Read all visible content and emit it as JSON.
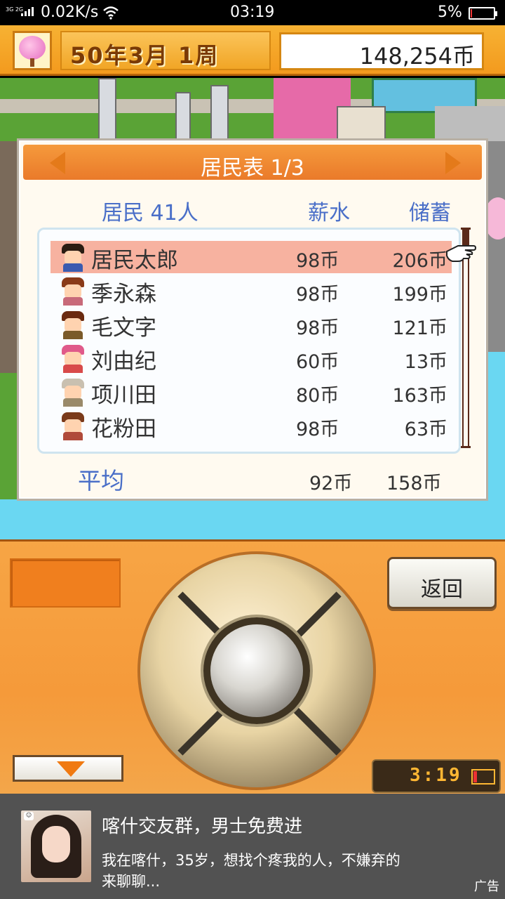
{
  "status_bar": {
    "network": "3G 2G",
    "speed": "0.02K/s",
    "time": "03:19",
    "battery": "5%"
  },
  "top_bar": {
    "date": "50年3月 1周",
    "money": "148,254币"
  },
  "resident_panel": {
    "title": "居民表 1/3",
    "headers": {
      "residents": "居民 41人",
      "salary": "薪水",
      "savings": "储蓄"
    },
    "rows": [
      {
        "name": "居民太郎",
        "salary": "98币",
        "savings": "206币",
        "selected": true,
        "hair": "#2b1c12",
        "body": "#3a5bb0"
      },
      {
        "name": "季永森",
        "salary": "98币",
        "savings": "199币",
        "selected": false,
        "hair": "#8a3a18",
        "body": "#c86a7a"
      },
      {
        "name": "毛文字",
        "salary": "98币",
        "savings": "121币",
        "selected": false,
        "hair": "#6a2a10",
        "body": "#7a5a2a"
      },
      {
        "name": "刘由纪",
        "salary": "60币",
        "savings": "13币",
        "selected": false,
        "hair": "#e05a8a",
        "body": "#d84a4a"
      },
      {
        "name": "项川田",
        "salary": "80币",
        "savings": "163币",
        "selected": false,
        "hair": "#c9c0b0",
        "body": "#9a8a6a"
      },
      {
        "name": "花粉田",
        "salary": "98币",
        "savings": "63币",
        "selected": false,
        "hair": "#7a3a1a",
        "body": "#b04a3a"
      }
    ],
    "average": {
      "label": "平均",
      "salary": "92币",
      "savings": "158币"
    }
  },
  "controller": {
    "back_label": "返回",
    "clock": "3:19"
  },
  "ad": {
    "title": "喀什交友群，男士免费进",
    "description": "我在喀什，35岁，想找个疼我的人，不嫌弃的来聊聊...",
    "label": "广告"
  }
}
